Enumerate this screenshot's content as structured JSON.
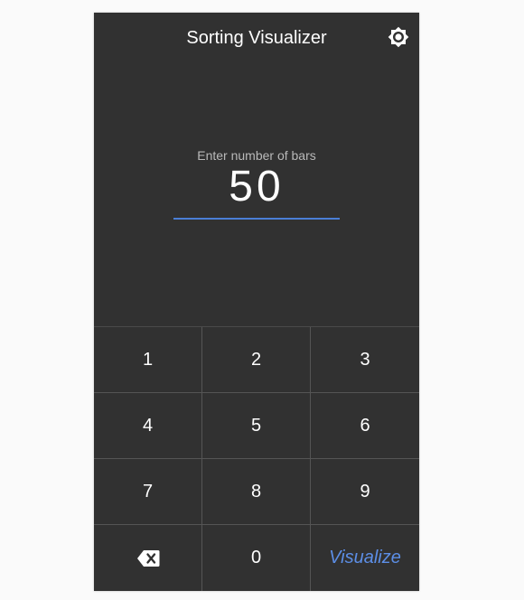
{
  "app": {
    "title": "Sorting Visualizer",
    "theme_icon": "brightness-icon"
  },
  "input": {
    "label": "Enter number of bars",
    "value": "50",
    "accent_color": "#4a7fd6"
  },
  "keypad": {
    "keys": [
      {
        "label": "1"
      },
      {
        "label": "2"
      },
      {
        "label": "3"
      },
      {
        "label": "4"
      },
      {
        "label": "5"
      },
      {
        "label": "6"
      },
      {
        "label": "7"
      },
      {
        "label": "8"
      },
      {
        "label": "9"
      },
      {
        "label": "",
        "icon": "backspace-icon"
      },
      {
        "label": "0"
      },
      {
        "label": "Visualize"
      }
    ],
    "visualize_color": "#5c8ee6"
  },
  "colors": {
    "background": "#313131",
    "text": "#ffffff"
  }
}
